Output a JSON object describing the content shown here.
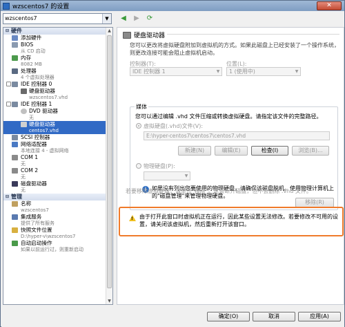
{
  "window": {
    "title": "wzscentos7 的设置",
    "close_label": "✕"
  },
  "toolbar": {
    "vm_selected": "wzscentos7"
  },
  "sidebar": {
    "hardware_header": "硬件",
    "items": [
      {
        "label": "添加硬件",
        "sub": ""
      },
      {
        "label": "BIOS",
        "sub": "从 CD 启动"
      },
      {
        "label": "内存",
        "sub": "8082 MB"
      },
      {
        "label": "处理器",
        "sub": "4 个虚拟处理器"
      },
      {
        "label": "IDE 控制器 0",
        "sub": ""
      },
      {
        "label": "硬盘驱动器",
        "sub": "wzscentos7.vhd"
      },
      {
        "label": "IDE 控制器 1",
        "sub": ""
      },
      {
        "label": "DVD 驱动器",
        "sub": "无"
      },
      {
        "label": "硬盘驱动器",
        "sub": "centos7.vhd"
      },
      {
        "label": "SCSI 控制器",
        "sub": ""
      },
      {
        "label": "网络适配器",
        "sub": "本地连接 4 - 虚拟网络"
      },
      {
        "label": "COM 1",
        "sub": "无"
      },
      {
        "label": "COM 2",
        "sub": "无"
      },
      {
        "label": "磁盘驱动器",
        "sub": "无"
      }
    ],
    "management_header": "管理",
    "mgmt_items": [
      {
        "label": "名称",
        "sub": "wzscentos7"
      },
      {
        "label": "集成服务",
        "sub": "提供了所有服务"
      },
      {
        "label": "快照文件位置",
        "sub": "D:\\hyper-v\\wzscentos7"
      },
      {
        "label": "自动启动操作",
        "sub": "如果以前运行过，则重新启动"
      }
    ]
  },
  "main": {
    "title": "硬盘驱动器",
    "description": "您可以更改将虚拟硬盘附加到虚拟机的方式。如果此磁盘上已经安装了一个操作系统，则更改连接可能会阻止虚拟机启动。",
    "controller_label": "控制器(T):",
    "controller_value": "IDE 控制器 1",
    "location_label": "位置(L):",
    "location_value": "1 (使用中)",
    "media_title": "媒体",
    "media_desc": "您可以通过编辑 .vhd 文件压缩或转换虚拟硬盘。请指定该文件的完整路径。",
    "vhd_radio_label": "虚拟硬盘(.vhd)文件(V):",
    "vhd_path": "E:\\hyper-centos7\\centos7\\centos7.vhd",
    "btn_new": "新建(N)",
    "btn_edit": "编辑(E)",
    "btn_inspect": "检查(I)",
    "btn_browse": "浏览(B)...",
    "physical_radio_label": "物理硬盘(P):",
    "info_text": "如果没有列出您要使用的物理硬盘，请确保该磁盘脱机。使用物理计算机上的\"磁盘管理\"来管理物理硬盘。",
    "remove_text": "若要移除虚拟硬盘，请单击\"移除\"。这会断开磁盘，但不会删除 .vhd 文件。",
    "btn_remove": "移除(R)",
    "warning_text": "由于打开此窗口时虚拟机正在运行，因此某些设置无法修改。若要修改不可用的设置，请关闭该虚拟机，然后重新打开该窗口。"
  },
  "footer": {
    "ok_label": "确定(O)",
    "cancel_label": "取消",
    "apply_label": "应用(A)"
  }
}
